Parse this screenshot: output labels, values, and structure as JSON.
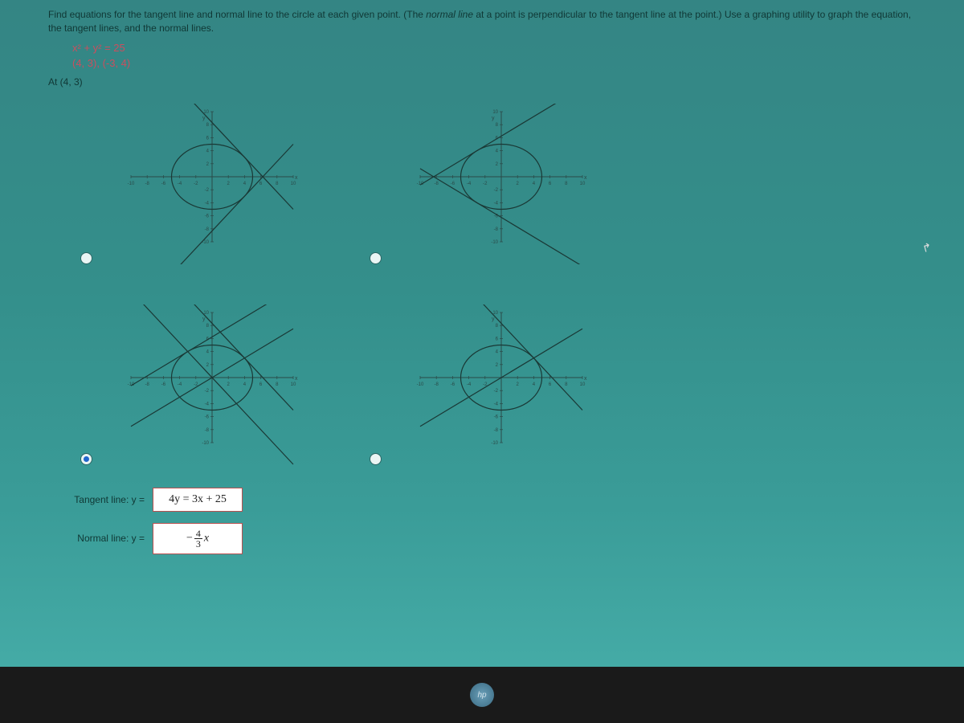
{
  "question": {
    "prompt_part1": "Find equations for the tangent line and normal line to the circle at each given point. (The ",
    "prompt_italic": "normal line",
    "prompt_part2": " at a point is perpendicular to the tangent line at the point.) Use a graphing utility to graph the equation, the tangent lines, and the normal lines.",
    "equation": "x² + y² = 25",
    "points": "(4, 3), (-3, 4)",
    "at_label": "At (4, 3)"
  },
  "options": {
    "a": {
      "selected": false
    },
    "b": {
      "selected": false
    },
    "c": {
      "selected": true
    },
    "d": {
      "selected": false
    }
  },
  "answers": {
    "tangent_label": "Tangent line:  y =",
    "tangent_value": "4y = 3x + 25",
    "normal_label": "Normal line:  y =",
    "normal_value_html": true
  },
  "chart_data": [
    {
      "type": "plot",
      "id": "option-a",
      "xlim": [
        -10,
        10
      ],
      "ylim": [
        -10,
        10
      ],
      "xticks": [
        -10,
        -8,
        -6,
        -4,
        -2,
        0,
        2,
        4,
        6,
        8,
        10
      ],
      "yticks": [
        -10,
        -8,
        -6,
        -4,
        -2,
        0,
        2,
        4,
        6,
        8,
        10
      ],
      "xlabel": "x",
      "ylabel": "y",
      "circle": {
        "cx": 0,
        "cy": 0,
        "r": 5
      },
      "lines": [
        {
          "slope": -1.333,
          "intercept": 8.333
        },
        {
          "slope": 1.333,
          "intercept": -8.333
        }
      ]
    },
    {
      "type": "plot",
      "id": "option-b",
      "xlim": [
        -10,
        10
      ],
      "ylim": [
        -10,
        10
      ],
      "xticks": [
        -10,
        -8,
        -6,
        -4,
        -2,
        0,
        2,
        4,
        6,
        8,
        10
      ],
      "yticks": [
        -10,
        -8,
        -6,
        -4,
        -2,
        0,
        2,
        4,
        6,
        8,
        10
      ],
      "xlabel": "x",
      "ylabel": "y",
      "circle": {
        "cx": 0,
        "cy": 0,
        "r": 5
      },
      "lines": [
        {
          "slope": 0.75,
          "intercept": 6.25
        },
        {
          "slope": -0.75,
          "intercept": -6.25
        }
      ]
    },
    {
      "type": "plot",
      "id": "option-c",
      "xlim": [
        -10,
        10
      ],
      "ylim": [
        -10,
        10
      ],
      "xticks": [
        -10,
        -8,
        -6,
        -4,
        -2,
        0,
        2,
        4,
        6,
        8,
        10
      ],
      "yticks": [
        -10,
        -8,
        -6,
        -4,
        -2,
        0,
        2,
        4,
        6,
        8,
        10
      ],
      "xlabel": "x",
      "ylabel": "y",
      "circle": {
        "cx": 0,
        "cy": 0,
        "r": 5
      },
      "lines": [
        {
          "slope": -1.333,
          "intercept": 8.333
        },
        {
          "slope": 0.75,
          "intercept": 0
        },
        {
          "slope": 0.75,
          "intercept": 6.25
        },
        {
          "slope": -1.333,
          "intercept": 0
        }
      ]
    },
    {
      "type": "plot",
      "id": "option-d",
      "xlim": [
        -10,
        10
      ],
      "ylim": [
        -10,
        10
      ],
      "xticks": [
        -10,
        -8,
        -6,
        -4,
        -2,
        0,
        2,
        4,
        6,
        8,
        10
      ],
      "yticks": [
        -10,
        -8,
        -6,
        -4,
        -2,
        0,
        2,
        4,
        6,
        8,
        10
      ],
      "xlabel": "x",
      "ylabel": "y",
      "circle": {
        "cx": 0,
        "cy": 0,
        "r": 5
      },
      "lines": [
        {
          "slope": -1.333,
          "intercept": 8.333
        },
        {
          "slope": 0.75,
          "intercept": 0
        }
      ]
    }
  ]
}
